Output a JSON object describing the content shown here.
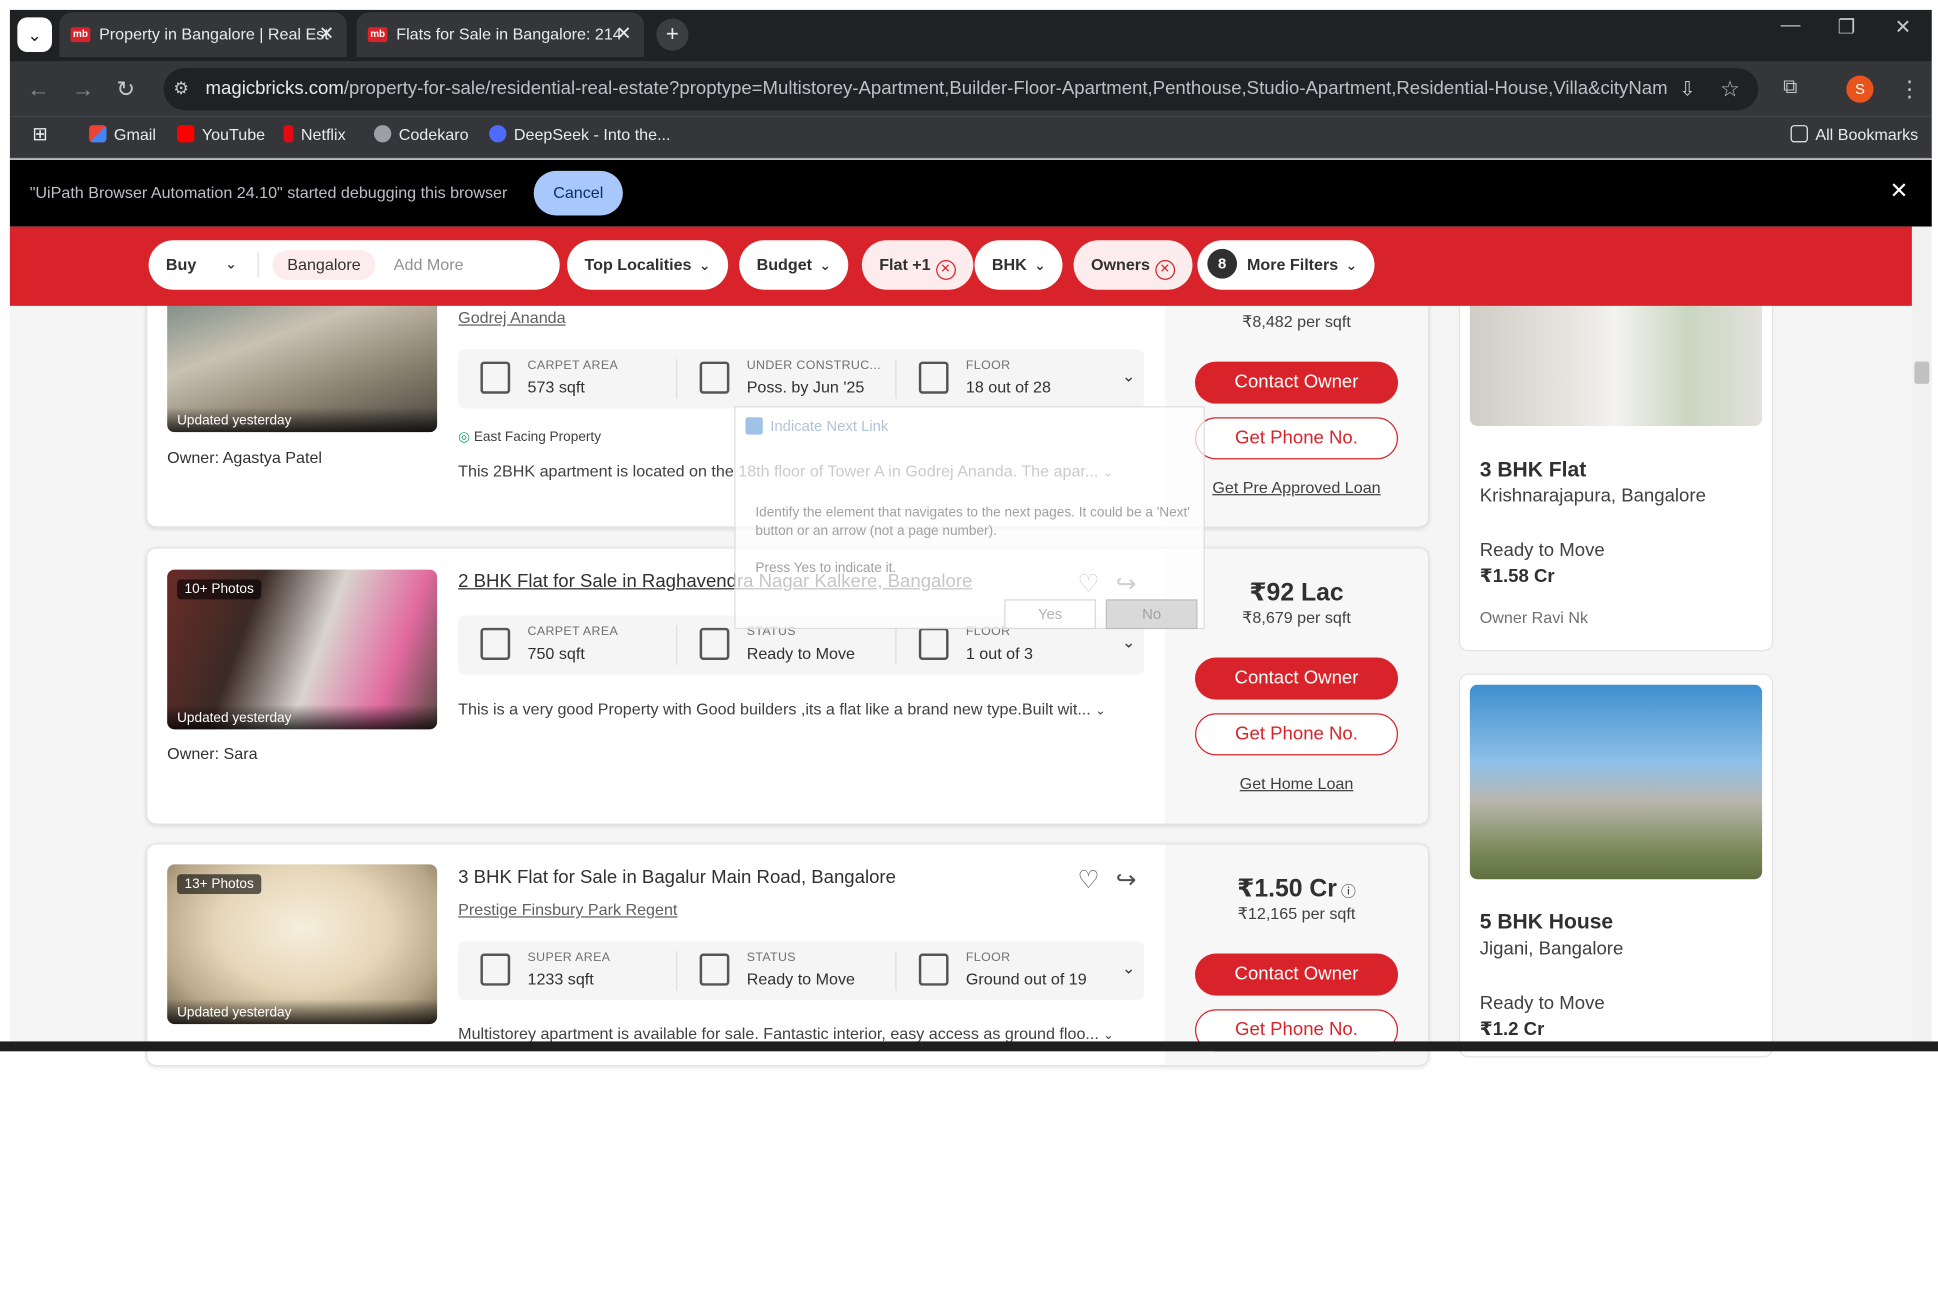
{
  "browser": {
    "tabs": [
      {
        "label": "Property in Bangalore | Real Est",
        "favicon": "mb"
      },
      {
        "label": "Flats for Sale in Bangalore: 214",
        "favicon": "mb"
      }
    ],
    "url_host": "magicbricks.com",
    "url_path": "/property-for-sale/residential-real-estate?proptype=Multistorey-Apartment,Builder-Floor-Apartment,Penthouse,Studio-Apartment,Residential-House,Villa&cityName=Ban...",
    "profile_initial": "S",
    "bookmarks": [
      "Gmail",
      "YouTube",
      "Netflix",
      "Codekaro",
      "DeepSeek - Into the...",
      "All Bookmarks"
    ],
    "infobar_text": "\"UiPath Browser Automation 24.10\" started debugging this browser",
    "infobar_cancel": "Cancel"
  },
  "filters": {
    "buy": "Buy",
    "city": "Bangalore",
    "add_more": "Add More",
    "top_localities": "Top Localities",
    "budget": "Budget",
    "flat": "Flat +1",
    "bhk": "BHK",
    "owners": "Owners",
    "more_count": "8",
    "more_filters": "More Filters"
  },
  "listings": [
    {
      "society": "Godrej Ananda",
      "updated": "Updated yesterday",
      "owner": "Owner: Agastya Patel",
      "s1_label": "CARPET AREA",
      "s1_value": "573 sqft",
      "s2_label": "UNDER CONSTRUC...",
      "s2_value": "Poss. by Jun '25",
      "s3_label": "FLOOR",
      "s3_value": "18 out of 28",
      "tag": "East Facing Property",
      "desc": "This 2BHK apartment is located on the 18th floor of Tower A in Godrej Ananda. The apar...",
      "ppsf": "₹8,482 per sqft",
      "contact": "Contact Owner",
      "phone": "Get Phone No.",
      "link": "Get Pre Approved Loan"
    },
    {
      "photos": "10+ Photos",
      "title": "2 BHK Flat for Sale in Raghavendra Nagar Kalkere, Bangalore",
      "updated": "Updated yesterday",
      "owner": "Owner: Sara",
      "s1_label": "CARPET AREA",
      "s1_value": "750 sqft",
      "s2_label": "STATUS",
      "s2_value": "Ready to Move",
      "s3_label": "FLOOR",
      "s3_value": "1 out of 3",
      "desc": "This is a very good Property with Good builders ,its a flat like a brand new type.Built wit...",
      "price": "₹92 Lac",
      "ppsf": "₹8,679 per sqft",
      "contact": "Contact Owner",
      "phone": "Get Phone No.",
      "link": "Get Home Loan"
    },
    {
      "photos": "13+ Photos",
      "title": "3 BHK Flat for Sale in Bagalur Main Road, Bangalore",
      "society": "Prestige Finsbury Park Regent",
      "updated": "Updated yesterday",
      "s1_label": "SUPER AREA",
      "s1_value": "1233 sqft",
      "s2_label": "STATUS",
      "s2_value": "Ready to Move",
      "s3_label": "FLOOR",
      "s3_value": "Ground out of 19",
      "desc": "Multistorey apartment is available for sale. Fantastic interior, easy access as ground floo...",
      "price": "₹1.50 Cr",
      "ppsf": "₹12,165 per sqft",
      "contact": "Contact Owner",
      "phone": "Get Phone No."
    }
  ],
  "sidebar": [
    {
      "title": "3 BHK Flat",
      "location": "Krishnarajapura, Bangalore",
      "status": "Ready to Move",
      "price": "₹1.58 Cr",
      "owner": "Owner Ravi Nk"
    },
    {
      "title": "5 BHK House",
      "location": "Jigani, Bangalore",
      "status": "Ready to Move",
      "price": "₹1.2 Cr"
    }
  ],
  "overlay": {
    "title": "Indicate Next Link",
    "question": "Identify the element that navigates to the next pages. It could be a 'Next' button or an arrow (not a page number).",
    "prompt": "Press Yes to indicate it.",
    "yes": "Yes",
    "no": "No"
  },
  "colors": {
    "brand_red": "#d8232a",
    "chrome_dark": "#202124",
    "chrome_mid": "#35363a",
    "cancel_blue": "#a8c7fa"
  }
}
